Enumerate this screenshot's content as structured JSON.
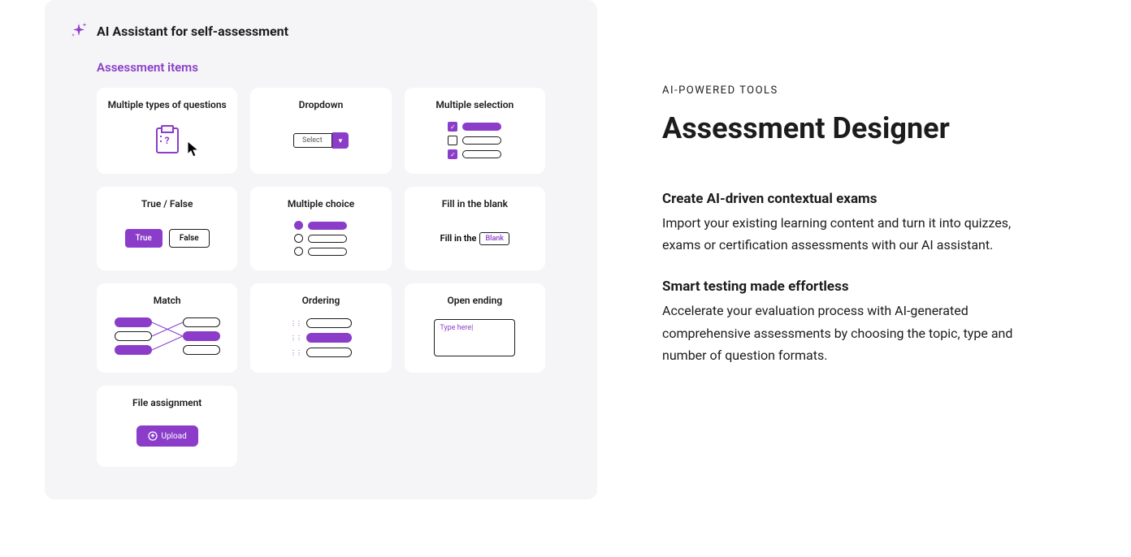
{
  "panel": {
    "title": "AI Assistant for self-assessment",
    "section_label": "Assessment items"
  },
  "cards": [
    {
      "title": "Multiple types of questions"
    },
    {
      "title": "Dropdown",
      "select_label": "Select"
    },
    {
      "title": "Multiple selection"
    },
    {
      "title": "True / False",
      "true_label": "True",
      "false_label": "False"
    },
    {
      "title": "Multiple choice"
    },
    {
      "title": "Fill in the blank",
      "prefix": "Fill in the",
      "blank_text": "Blank"
    },
    {
      "title": "Match"
    },
    {
      "title": "Ordering"
    },
    {
      "title": "Open ending",
      "placeholder": "Type here"
    },
    {
      "title": "File assignment",
      "upload_label": "Upload"
    }
  ],
  "right": {
    "eyebrow": "AI-POWERED TOOLS",
    "heading": "Assessment Designer",
    "blocks": [
      {
        "title": "Create AI-driven contextual exams",
        "text": "Import your existing learning content and turn it into quizzes, exams or certification assessments with our AI assistant."
      },
      {
        "title": "Smart testing made effortless",
        "text": "Accelerate your evaluation process with AI-generated comprehensive assessments by choosing the topic, type and number of question formats."
      }
    ]
  },
  "colors": {
    "accent": "#8b3dc9",
    "text": "#1c1c1c"
  }
}
